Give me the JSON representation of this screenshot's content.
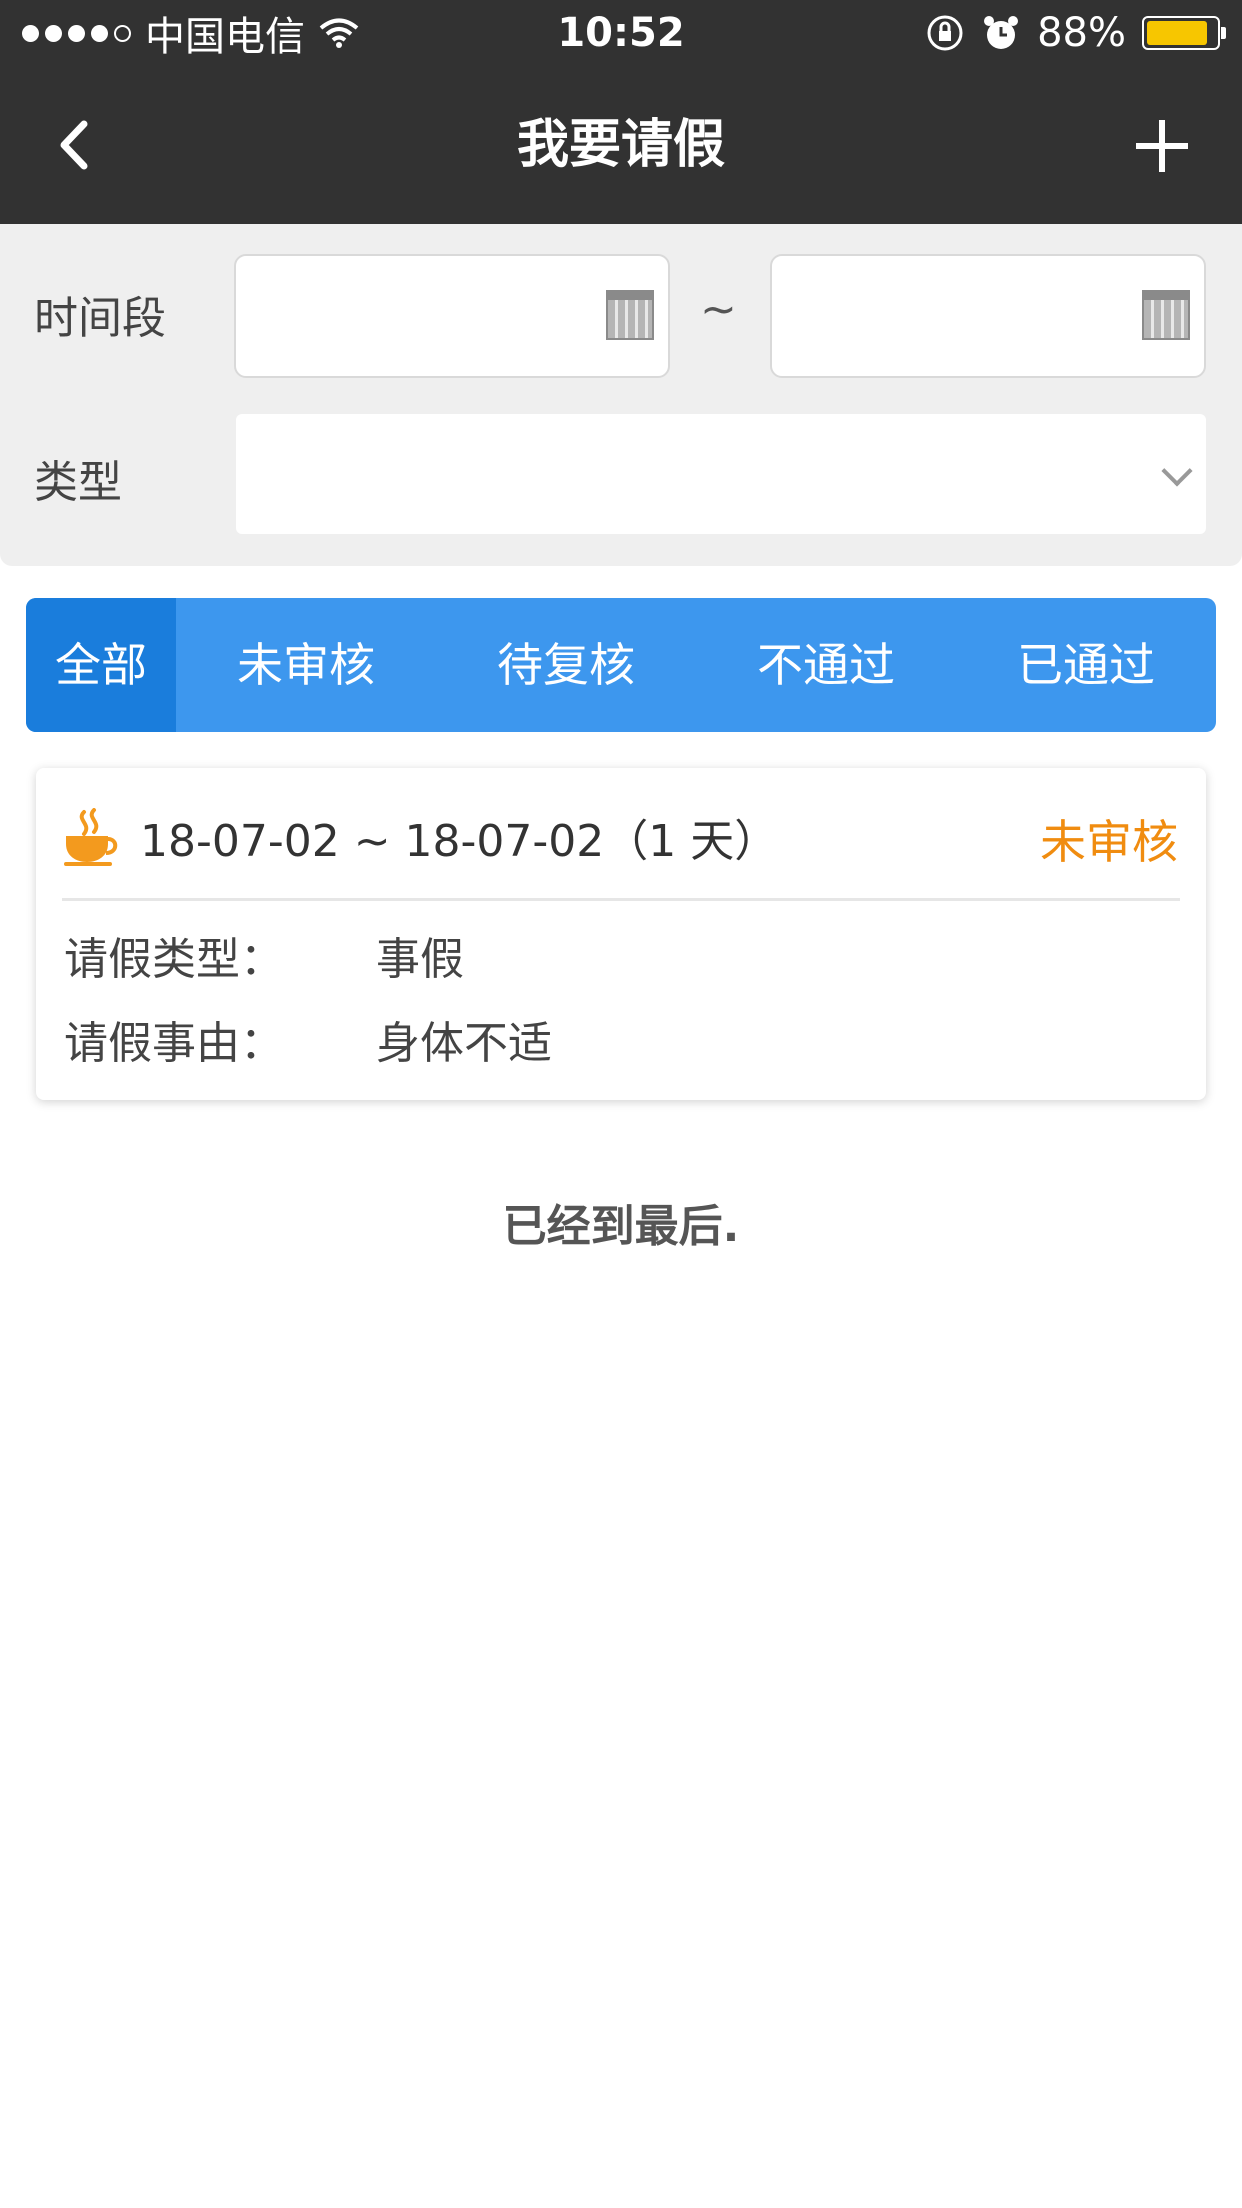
{
  "status_bar": {
    "carrier": "中国电信",
    "time": "10:52",
    "battery_percent": "88%",
    "battery_level": 0.88,
    "signal_bars_filled": 4,
    "signal_bars_total": 5
  },
  "nav": {
    "title": "我要请假",
    "back_icon": "chevron-left-icon",
    "add_icon": "plus-icon"
  },
  "filter": {
    "time_label": "时间段",
    "start_date": "",
    "end_date": "",
    "separator": "~",
    "type_label": "类型",
    "type_value": ""
  },
  "tabs": [
    {
      "label": "全部",
      "active": true
    },
    {
      "label": "未审核",
      "active": false
    },
    {
      "label": "待复核",
      "active": false
    },
    {
      "label": "不通过",
      "active": false
    },
    {
      "label": "已通过",
      "active": false
    }
  ],
  "records": [
    {
      "date_range": "18-07-02 ~ 18-07-02（1 天）",
      "status": "未审核",
      "type_key": "请假类型：",
      "type_value": "事假",
      "reason_key": "请假事由：",
      "reason_value": "身体不适"
    }
  ],
  "end_message": "已经到最后.",
  "colors": {
    "dark_bar": "#323232",
    "tab_blue": "#3d97ee",
    "tab_active": "#1a7ddc",
    "status_orange": "#f08c10",
    "battery_yellow": "#f7c600"
  }
}
